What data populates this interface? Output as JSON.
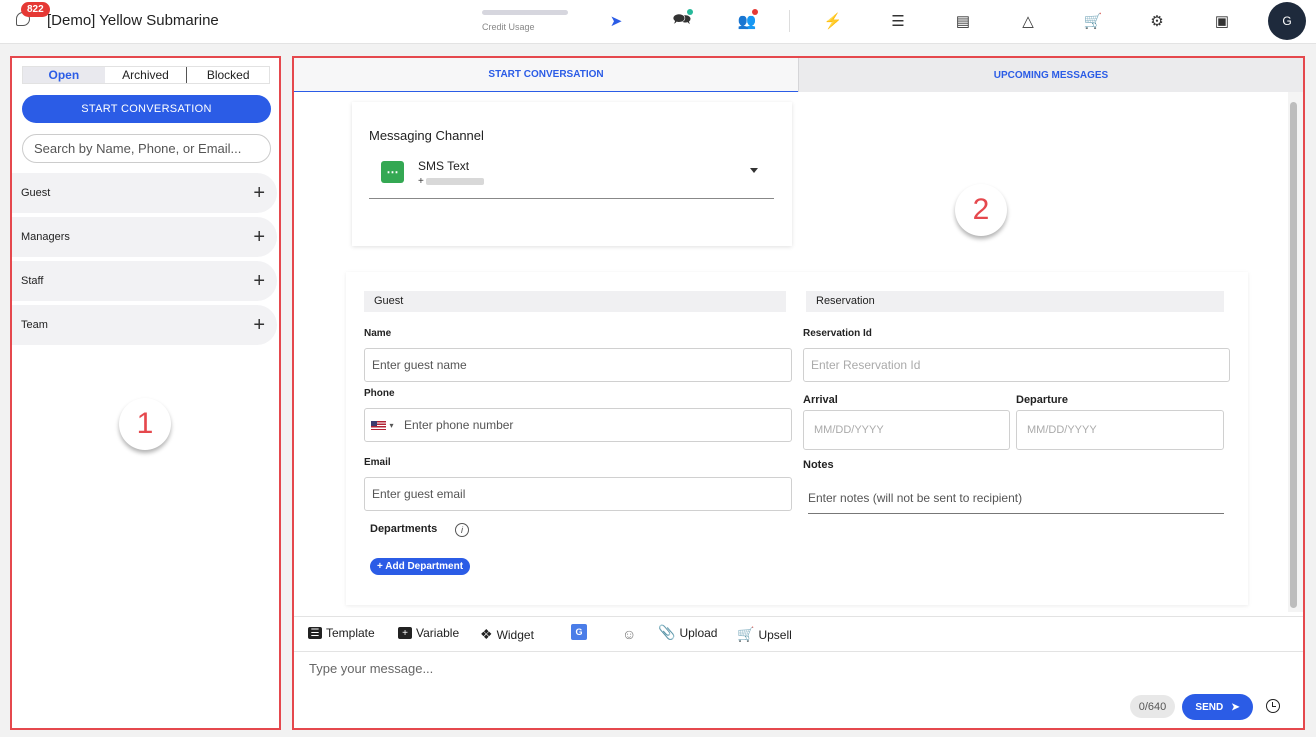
{
  "header": {
    "notification_count": "822",
    "app_title": "[Demo] Yellow Submarine",
    "credit_label": "Credit Usage",
    "avatar_initial": "G",
    "accent_color": "#2b5ce6",
    "icons": [
      "send-icon",
      "conversations-icon",
      "contacts-icon",
      "bolt-icon",
      "checklist-icon",
      "analytics-icon",
      "service-bell-icon",
      "cart-icon",
      "gear-icon",
      "profile-badge-icon"
    ]
  },
  "sidebar": {
    "filters": [
      "Open",
      "Archived",
      "Blocked"
    ],
    "start_button": "START CONVERSATION",
    "search_placeholder": "Search by Name, Phone, or Email...",
    "groups": [
      "Guest",
      "Managers",
      "Staff",
      "Team"
    ],
    "marker": "1"
  },
  "main": {
    "tabs": [
      "START CONVERSATION",
      "UPCOMING MESSAGES"
    ],
    "marker": "2",
    "channel": {
      "label": "Messaging Channel",
      "name": "SMS Text",
      "number_prefix": "+"
    },
    "guest": {
      "heading": "Guest",
      "name_label": "Name",
      "name_placeholder": "Enter guest name",
      "phone_label": "Phone",
      "phone_placeholder": "Enter phone number",
      "email_label": "Email",
      "email_placeholder": "Enter guest email",
      "departments_label": "Departments",
      "add_department": "+ Add Department"
    },
    "reservation": {
      "heading": "Reservation",
      "id_label": "Reservation Id",
      "id_placeholder": "Enter Reservation Id",
      "arrival_label": "Arrival",
      "arrival_placeholder": "MM/DD/YYYY",
      "departure_label": "Departure",
      "departure_placeholder": "MM/DD/YYYY",
      "notes_label": "Notes",
      "notes_placeholder": "Enter notes (will not be sent to recipient)"
    }
  },
  "composer": {
    "tools": [
      "Template",
      "Variable",
      "Widget",
      "Upload",
      "Upsell"
    ],
    "message_placeholder": "Type your message...",
    "counter": "0/640",
    "send": "SEND"
  }
}
